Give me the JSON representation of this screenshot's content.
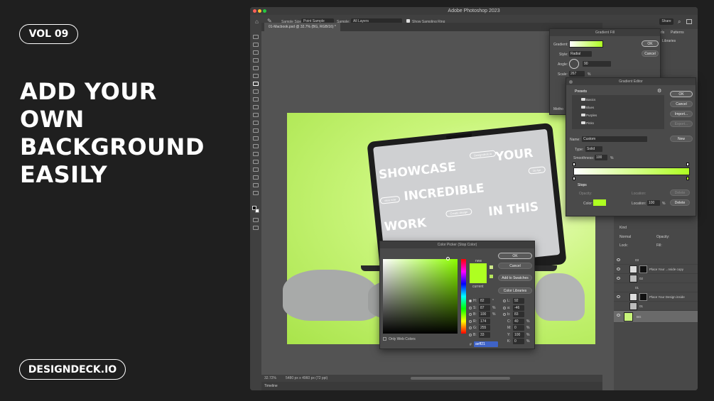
{
  "promo": {
    "vol": "VOL 09",
    "headline": [
      "ADD YOUR",
      "OWN",
      "BACKGROUND",
      "EASILY"
    ],
    "brand": "DESIGNDECK.IO"
  },
  "app": {
    "title": "Adobe Photoshop 2023",
    "options": {
      "sample_size_label": "Sample Size:",
      "sample_size_value": "Point Sample",
      "sample_label": "Sample:",
      "sample_value": "All Layers",
      "sampling_ring": "Show Sampling Ring",
      "share": "Share"
    },
    "doc_tab": "01-Macbook.psd @ 32.7% (BG, RGB/16) *",
    "status_zoom": "32.72%",
    "status_size": "5480 px x 4960 px (72 ppi)",
    "timeline": "Timeline"
  },
  "panels": {
    "tabs": [
      "rls",
      "Patterns"
    ],
    "libraries": "Libraries",
    "search": "Kind",
    "blend": "Normal",
    "opacity": "Opacity:",
    "lock": "Lock:",
    "fill": "Fill:",
    "layers": [
      {
        "name": "03",
        "type": "group"
      },
      {
        "name": "Place Your ...nside copy",
        "type": "smart"
      },
      {
        "name": "02",
        "type": "layer"
      },
      {
        "name": "01",
        "type": "group"
      },
      {
        "name": "Place Your Design inside",
        "type": "smart"
      },
      {
        "name": "01",
        "type": "layer"
      },
      {
        "name": "BG",
        "type": "fill"
      }
    ]
  },
  "screen_text": {
    "w1": "SHOWCASE",
    "w2": "YOUR",
    "w3": "INCREDIBLE",
    "w4": "WORK",
    "w5": "IN THIS",
    "pill1": "Designdeck.io",
    "pill2": "16 Apr",
    "pill3": "view now",
    "pill4": "Create design"
  },
  "gradient_fill": {
    "title": "Gradient Fill",
    "gradient_label": "Gradient:",
    "style_label": "Style:",
    "style_value": "Radial",
    "angle_label": "Angle:",
    "angle_value": "90",
    "scale_label": "Scale:",
    "scale_value": "267",
    "scale_unit": "%",
    "method_label": "Metho",
    "ok": "OK",
    "cancel": "Cancel"
  },
  "gradient_editor": {
    "title": "Gradient Editor",
    "presets_label": "Presets",
    "presets": [
      "Basics",
      "Blues",
      "Purples",
      "Pinks"
    ],
    "ok": "OK",
    "cancel": "Cancel",
    "import": "Import...",
    "export": "Export...",
    "name_label": "Name:",
    "name_value": "Custom",
    "new": "New",
    "type_label": "Type:",
    "type_value": "Solid",
    "smoothness_label": "Smoothness:",
    "smoothness_value": "100",
    "smoothness_unit": "%",
    "stops_label": "Stops",
    "opacity_label": "Opacity:",
    "location_label": "Location:",
    "delete": "Delete",
    "color_label": "Color:",
    "location_value": "100",
    "unit": "%"
  },
  "color_picker": {
    "title": "Color Picker (Stop Color)",
    "new_label": "new",
    "current_label": "current",
    "ok": "OK",
    "cancel": "Cancel",
    "add_swatches": "Add to Swatches",
    "color_libraries": "Color Libraries",
    "only_web": "Only Web Colors",
    "hsb": [
      {
        "k": "H:",
        "v": "82",
        "u": "°"
      },
      {
        "k": "S:",
        "v": "87",
        "u": "%"
      },
      {
        "k": "B:",
        "v": "100",
        "u": "%"
      }
    ],
    "rgb": [
      {
        "k": "R:",
        "v": "174",
        "u": ""
      },
      {
        "k": "G:",
        "v": "255",
        "u": ""
      },
      {
        "k": "B:",
        "v": "33",
        "u": ""
      }
    ],
    "lab": [
      {
        "k": "L:",
        "v": "92",
        "u": ""
      },
      {
        "k": "a:",
        "v": "-46",
        "u": ""
      },
      {
        "k": "b:",
        "v": "83",
        "u": ""
      }
    ],
    "cmyk": [
      {
        "k": "C:",
        "v": "40",
        "u": "%"
      },
      {
        "k": "M:",
        "v": "0",
        "u": "%"
      },
      {
        "k": "Y:",
        "v": "100",
        "u": "%"
      },
      {
        "k": "K:",
        "v": "0",
        "u": "%"
      }
    ],
    "hex_label": "#",
    "hex_value": "aeff21"
  },
  "colors": {
    "accent": "#aeff21",
    "bg": "#1f1f1f",
    "app": "#535353"
  },
  "icons": [
    "home-icon",
    "eyedropper-icon",
    "search-icon",
    "eye-icon",
    "folder-icon",
    "gear-icon"
  ]
}
